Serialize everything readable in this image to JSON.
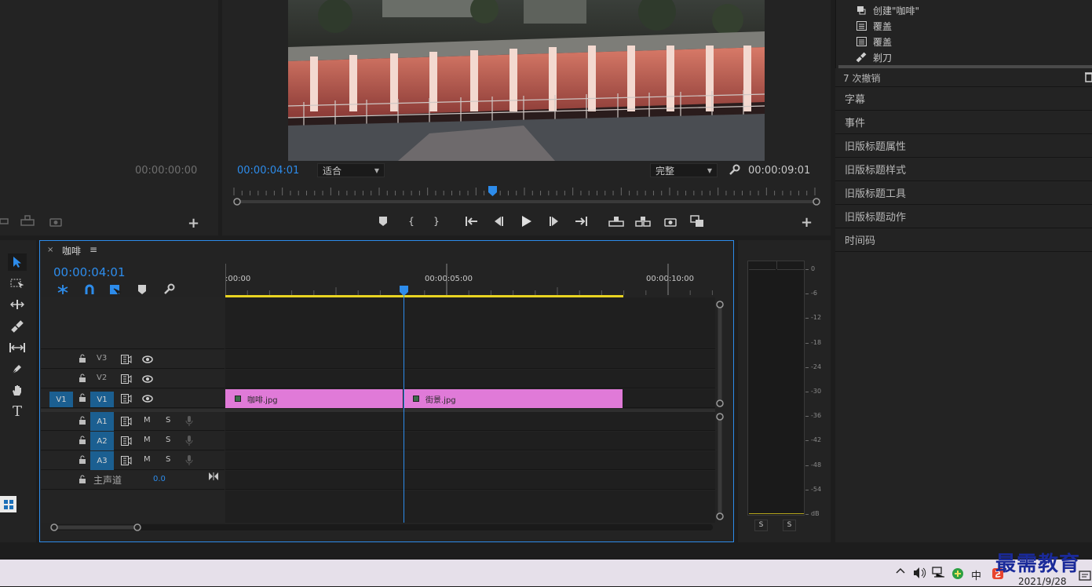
{
  "source_monitor": {
    "timecode": "00:00:00:00"
  },
  "program_monitor": {
    "current_time": "00:00:04:01",
    "zoom_select": "适合",
    "quality_select": "完整",
    "duration": "00:00:09:01",
    "playhead_fraction": 0.445
  },
  "history": {
    "items": [
      {
        "label": "创建\"咖啡\"",
        "icon": "sequence-icon"
      },
      {
        "label": "覆盖",
        "icon": "list-icon"
      },
      {
        "label": "覆盖",
        "icon": "list-icon"
      },
      {
        "label": "剃刀",
        "icon": "razor-icon"
      }
    ],
    "undo_count": "7 次撤销"
  },
  "right_panels": [
    "字幕",
    "事件",
    "旧版标题属性",
    "旧版标题样式",
    "旧版标题工具",
    "旧版标题动作",
    "时间码"
  ],
  "timeline": {
    "sequence_name": "咖啡",
    "current_time": "00:00:04:01",
    "ruler": [
      ":00:00",
      "00:00:05:00",
      "00:00:10:00"
    ],
    "video_tracks": [
      {
        "name": "V3",
        "source": ""
      },
      {
        "name": "V2",
        "source": ""
      },
      {
        "name": "V1",
        "source": "V1"
      }
    ],
    "audio_tracks": [
      {
        "name": "A1",
        "m": "M",
        "s": "S"
      },
      {
        "name": "A2",
        "m": "M",
        "s": "S"
      },
      {
        "name": "A3",
        "m": "M",
        "s": "S"
      }
    ],
    "master": {
      "label": "主声道",
      "value": "0.0"
    },
    "clips": [
      {
        "name": "咖啡.jpg"
      },
      {
        "name": "街景.jpg"
      }
    ]
  },
  "audio_meter": {
    "scale": [
      "0",
      "-6",
      "-12",
      "-18",
      "-24",
      "-30",
      "-36",
      "-42",
      "-48",
      "-54",
      "dB"
    ],
    "solo_left": "S",
    "solo_right": "S"
  },
  "taskbar": {
    "ime": "中",
    "date": "2021/9/28",
    "watermark": "最需教育"
  },
  "colors": {
    "accent_blue": "#2d8ceb",
    "clip_pink": "#e07ad8",
    "work_area_yellow": "#e8d422",
    "track_blue": "#1b5f91"
  }
}
